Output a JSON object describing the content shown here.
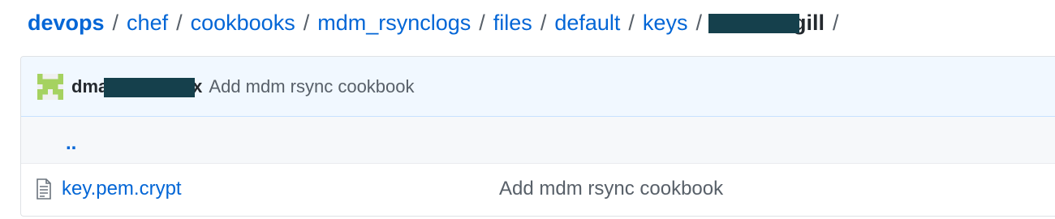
{
  "breadcrumb": {
    "root": "devops",
    "separator": "/",
    "segments": [
      "chef",
      "cookbooks",
      "mdm_rsynclogs",
      "files",
      "default",
      "keys"
    ],
    "final": "dev_cargill"
  },
  "commit": {
    "author": "dmarkeycloudx",
    "message": "Add mdm rsync cookbook"
  },
  "up_link": "..",
  "files": [
    {
      "name": "key.pem.crypt",
      "commit_message": "Add mdm rsync cookbook"
    }
  ],
  "colors": {
    "link": "#0366d6",
    "redaction": "#15404c",
    "commit_bar_bg": "#f1f8ff",
    "avatar": "#a5d260"
  },
  "icons": {
    "avatar": "identicon",
    "file": "file-text-icon"
  }
}
